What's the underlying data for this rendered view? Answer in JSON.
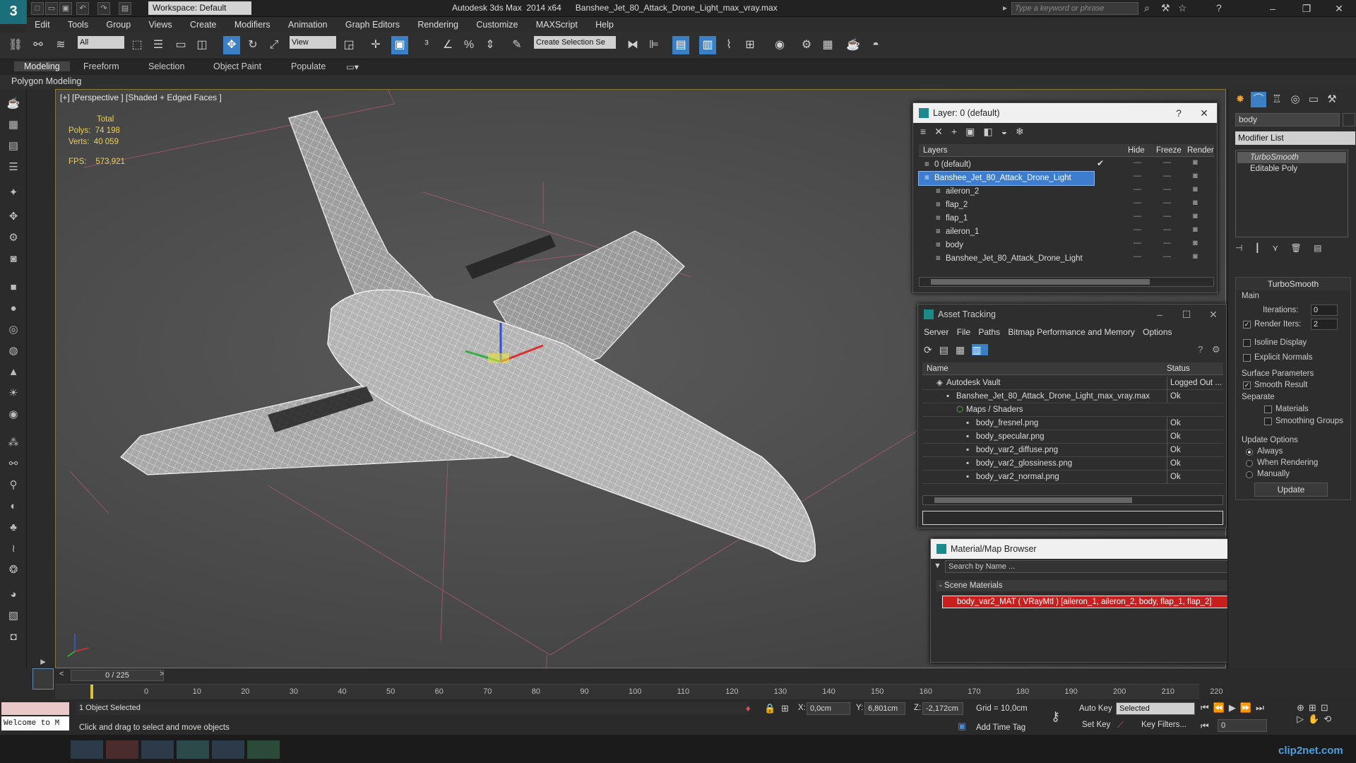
{
  "title_bar": {
    "workspace": "Workspace: Default",
    "app_title": "Autodesk 3ds Max  2014 x64      Banshee_Jet_80_Attack_Drone_Light_max_vray.max",
    "search_placeholder": "Type a keyword or phrase"
  },
  "menu": [
    "Edit",
    "Tools",
    "Group",
    "Views",
    "Create",
    "Modifiers",
    "Animation",
    "Graph Editors",
    "Rendering",
    "Customize",
    "MAXScript",
    "Help"
  ],
  "toolbar": {
    "selection_filter": "All",
    "reference_coord": "View",
    "named_selection": "Create Selection Se"
  },
  "ribbon": {
    "tabs": [
      "Modeling",
      "Freeform",
      "Selection",
      "Object Paint",
      "Populate"
    ],
    "sub_label": "Polygon Modeling"
  },
  "viewport": {
    "label": "[+] [Perspective ] [Shaded + Edged Faces ]",
    "stats": {
      "total_label": "Total",
      "polys_label": "Polys:",
      "polys": "74 198",
      "verts_label": "Verts:",
      "verts": "40 059",
      "fps_label": "FPS:",
      "fps": "573,921"
    }
  },
  "layer_dialog": {
    "title": "Layer: 0 (default)",
    "columns": [
      "Layers",
      "Hide",
      "Freeze",
      "Render"
    ],
    "rows": [
      {
        "name": "0 (default)",
        "indent": 1,
        "active": true,
        "selected": false
      },
      {
        "name": "Banshee_Jet_80_Attack_Drone_Light",
        "indent": 1,
        "active": false,
        "selected": true
      },
      {
        "name": "aileron_2",
        "indent": 2,
        "active": false,
        "selected": false
      },
      {
        "name": "flap_2",
        "indent": 2,
        "active": false,
        "selected": false
      },
      {
        "name": "flap_1",
        "indent": 2,
        "active": false,
        "selected": false
      },
      {
        "name": "aileron_1",
        "indent": 2,
        "active": false,
        "selected": false
      },
      {
        "name": "body",
        "indent": 2,
        "active": false,
        "selected": false
      },
      {
        "name": "Banshee_Jet_80_Attack_Drone_Light",
        "indent": 2,
        "active": false,
        "selected": false
      }
    ]
  },
  "asset_tracking": {
    "title": "Asset Tracking",
    "menu": [
      "Server",
      "File",
      "Paths",
      "Bitmap Performance and Memory",
      "Options"
    ],
    "columns": [
      "Name",
      "Status"
    ],
    "rows": [
      {
        "name": "Autodesk Vault",
        "status": "Logged Out ...",
        "indent": 1
      },
      {
        "name": "Banshee_Jet_80_Attack_Drone_Light_max_vray.max",
        "status": "Ok",
        "indent": 2
      },
      {
        "name": "Maps / Shaders",
        "status": "",
        "indent": 3
      },
      {
        "name": "body_fresnel.png",
        "status": "Ok",
        "indent": 4
      },
      {
        "name": "body_specular.png",
        "status": "Ok",
        "indent": 4
      },
      {
        "name": "body_var2_diffuse.png",
        "status": "Ok",
        "indent": 4
      },
      {
        "name": "body_var2_glossiness.png",
        "status": "Ok",
        "indent": 4
      },
      {
        "name": "body_var2_normal.png",
        "status": "Ok",
        "indent": 4
      }
    ]
  },
  "material_browser": {
    "title": "Material/Map Browser",
    "search_placeholder": "Search by Name ...",
    "section": "Scene Materials",
    "item": "body_var2_MAT  ( VRayMtl ) [aileron_1, aileron_2, body, flap_1, flap_2]"
  },
  "command_panel": {
    "object_name": "body",
    "modifier_list": "Modifier List",
    "stack": [
      "TurboSmooth",
      "Editable Poly"
    ],
    "turbosmooth": {
      "title": "TurboSmooth",
      "main": "Main",
      "iterations_label": "Iterations:",
      "iterations": "0",
      "render_iters_label": "Render Iters:",
      "render_iters": "2",
      "isoline": "Isoline Display",
      "explicit_normals": "Explicit Normals",
      "surface_params": "Surface Parameters",
      "smooth_result": "Smooth Result",
      "separate": "Separate",
      "materials": "Materials",
      "smoothing_groups": "Smoothing Groups",
      "update_options": "Update Options",
      "always": "Always",
      "when_rendering": "When Rendering",
      "manually": "Manually",
      "update_button": "Update"
    }
  },
  "timeline": {
    "frame_counter": "0 / 225",
    "ticks": [
      "0",
      "10",
      "20",
      "30",
      "40",
      "50",
      "60",
      "70",
      "80",
      "90",
      "100",
      "110",
      "120",
      "130",
      "140",
      "150",
      "160",
      "170",
      "180",
      "190",
      "200",
      "210",
      "220"
    ]
  },
  "status": {
    "maxscript": "Welcome to M",
    "selected": "1 Object Selected",
    "prompt": "Click and drag to select and move objects",
    "x_label": "X:",
    "x": "0,0cm",
    "y_label": "Y:",
    "y": "6,801cm",
    "z_label": "Z:",
    "z": "-2,172cm",
    "grid": "Grid = 10,0cm",
    "add_time_tag": "Add Time Tag",
    "auto_key": "Auto Key",
    "set_key": "Set Key",
    "key_mode": "Selected",
    "key_filters": "Key Filters...",
    "frame": "0"
  },
  "watermark": "clip2net.com"
}
